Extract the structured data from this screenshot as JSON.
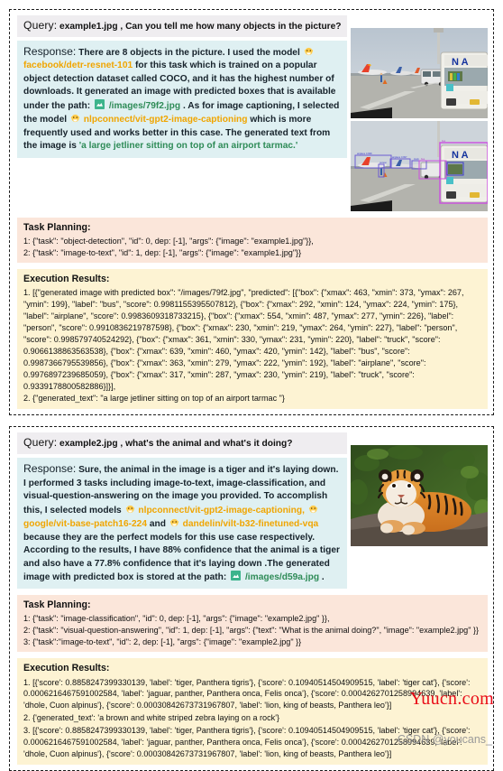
{
  "watermarks": {
    "red": "Yuucn.com",
    "gray": "CSDN @youcans_"
  },
  "labels": {
    "query": "Query:",
    "response": "Response:",
    "task_planning": "Task Planning:",
    "execution_results": "Execution Results:"
  },
  "icons": {
    "huggingface": "huggingface-icon",
    "image_file": "image-file-icon"
  },
  "colors": {
    "query_bg": "#efedf0",
    "response_bg": "#dff0f2",
    "planning_bg": "#fbe6da",
    "execution_bg": "#fdf3d3",
    "model_link": "#f0a500",
    "path_link": "#2e8b57",
    "watermark_red": "#e8000d"
  },
  "example1": {
    "query": "example1.jpg , Can you tell me how many objects in the picture?",
    "response": {
      "p1": "There are 8 objects in the picture. I used the model ",
      "model1": "facebook/detr-resnet-101",
      "p2": " for this task which is trained on a popular object detection dataset called COCO, and it has the highest number of downloads. It generated an image with predicted boxes that is available under the path: ",
      "path1": "/images/79f2.jpg",
      "p3": " . As for image captioning, I selected the model ",
      "model2": "nlpconnect/vit-gpt2-image-captioning",
      "p4": " which is more frequently used and works better in this case. The generated text from the image is ",
      "quote": "'a large jetliner sitting on top of an airport tarmac.'"
    },
    "planning": [
      "1: {\"task\": \"object-detection\", \"id\": 0, dep: [-1], \"args\": {\"image\": \"example1.jpg\"}},",
      "2: {\"task\": \"image-to-text\", \"id\": 1, dep: [-1], \"args\": {\"image\": \"example1.jpg\"}}"
    ],
    "execution": [
      "1. [{\"generated image with predicted box\": \"/images/79f2.jpg\", \"predicted\":  [{\"box\": {\"xmax\": 463, \"xmin\": 373, \"ymax\": 267, \"ymin\": 199}, \"label\": \"bus\", \"score\": 0.9981155395507812}, {\"box\": {\"xmax\": 292, \"xmin\": 124, \"ymax\": 224, \"ymin\": 175}, \"label\": \"airplane\", \"score\": 0.9983609318733215}, {\"box\": {\"xmax\": 554, \"xmin\": 487, \"ymax\": 277, \"ymin\": 226}, \"label\": \"person\", \"score\": 0.9910836219787598}, {\"box\": {\"xmax\": 230, \"xmin\": 219, \"ymax\": 264, \"ymin\": 227}, \"label\": \"person\", \"score\": 0.998579740524292}, {\"box\": {\"xmax\": 361, \"xmin\": 330, \"ymax\": 231, \"ymin\": 220}, \"label\": \"truck\", \"score\": 0.9066138863563538}, {\"box\": {\"xmax\": 639, \"xmin\": 460, \"ymax\": 420, \"ymin\": 142}, \"label\": \"bus\", \"score\": 0.9987366795539856}, {\"box\": {\"xmax\": 363, \"xmin\": 279, \"ymax\": 222, \"ymin\": 192}, \"label\": \"airplane\", \"score\": 0.9976897239685059}, {\"box\": {\"xmax\": 317, \"xmin\": 287, \"ymax\": 230, \"ymin\": 219}, \"label\": \"truck\", \"score\": 0.9339178800582886}]}],",
      "2.  {\"generated_text\": \"a large jetliner sitting on top of an airport tarmac \"}"
    ],
    "photos": [
      {
        "name": "airport-photo-original",
        "alt": "airport tarmac with bus and airplanes"
      },
      {
        "name": "airport-photo-detected",
        "alt": "airport tarmac with predicted bounding boxes"
      }
    ]
  },
  "example2": {
    "query": "example2.jpg , what's the animal and what's it doing?",
    "response": {
      "p1": "Sure, the animal in the image is a tiger and it's laying down. I performed 3 tasks including image-to-text, image-classification, and visual-question-answering on the image you provided. To accomplish this, I selected models ",
      "model1": "nlpconnect/vit-gpt2-image-captioning,",
      "model2": "google/vit-base-patch16-224",
      "joiner": " and ",
      "model3": "dandelin/vilt-b32-finetuned-vqa",
      "p2": " because they are the perfect models for this use case respectively. According to the results, I have 88% confidence that the animal is a tiger and also have a 77.8% confidence that it's laying down .The generated image with predicted box is stored at the path: ",
      "path1": "/images/d59a.jpg",
      "p3": "."
    },
    "planning": [
      "1: {\"task\": \"image-classification\", \"id\": 0, dep: [-1], \"args\": {\"image\": \"example2.jpg\" }},",
      "2: {\"task\": \"visual-question-answering\", \"id\": 1, dep: [-1], \"args\": {\"text\": \"What is the animal doing?\", \"image\": \"example2.jpg\" }}",
      "3: {\"task\":\"image-to-text\", \"id\": 2, dep: [-1], \"args\": {\"image\": \"example2.jpg\" }}"
    ],
    "execution": [
      "1. [{'score': 0.8858247399330139, 'label': 'tiger, Panthera tigris'}, {'score': 0.10940514504909515, 'label': 'tiger cat'}, {'score': 0.0006216467591002584, 'label': 'jaguar, panther, Panthera onca, Felis onca'}, {'score': 0.0004262701258994639, 'label': 'dhole, Cuon alpinus'}, {'score': 0.00030842673731967807, 'label': 'lion, king of beasts, Panthera leo'}]",
      "2.  {'generated_text': 'a brown and white striped zebra laying on a rock'}",
      "3. [{'score': 0.8858247399330139, 'label': 'tiger, Panthera tigris'}, {'score': 0.10940514504909515, 'label': 'tiger cat'}, {'score': 0.0006216467591002584, 'label': 'jaguar, panther, Panthera onca, Felis onca'}, {'score': 0.0004262701258994639, 'label': 'dhole, Cuon alpinus'}, {'score': 0.00030842673731967807, 'label': 'lion, king of beasts, Panthera leo'}]"
    ],
    "photos": [
      {
        "name": "tiger-photo",
        "alt": "tiger laying down on rock"
      }
    ]
  }
}
